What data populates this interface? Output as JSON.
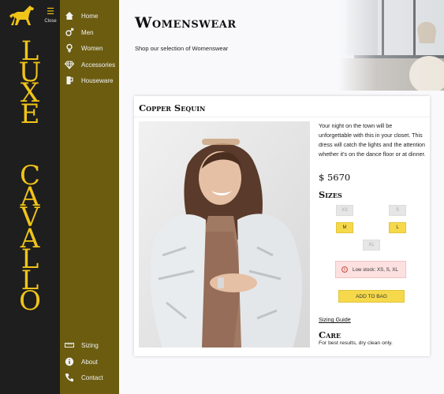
{
  "brand": {
    "word1": [
      "L",
      "U",
      "X",
      "E"
    ],
    "word2": [
      "C",
      "A",
      "V",
      "A",
      "L",
      "L",
      "O"
    ]
  },
  "close_label": "Close",
  "nav": {
    "items": [
      {
        "label": "Home",
        "icon": "home-icon"
      },
      {
        "label": "Men",
        "icon": "male-icon"
      },
      {
        "label": "Women",
        "icon": "female-icon"
      },
      {
        "label": "Accessories",
        "icon": "diamond-icon"
      },
      {
        "label": "Houseware",
        "icon": "houseware-icon"
      }
    ],
    "bottom_items": [
      {
        "label": "Sizing",
        "icon": "ruler-icon"
      },
      {
        "label": "About",
        "icon": "info-icon"
      },
      {
        "label": "Contact",
        "icon": "phone-icon"
      }
    ]
  },
  "page": {
    "title": "Womenswear",
    "subtitle": "Shop our selection of Womenswear"
  },
  "product": {
    "name": "Copper Sequin",
    "description": "Your night on the town will be unforgettable with this in your closet. This dress will catch the lights and the attention whether it's on the dance floor or at dinner.",
    "price": "$ 5670",
    "sizes_heading": "Sizes",
    "sizes": [
      {
        "label": "XS",
        "available": false
      },
      {
        "label": "S",
        "available": false
      },
      {
        "label": "M",
        "available": true
      },
      {
        "label": "L",
        "available": true
      },
      {
        "label": "XL",
        "available": false
      }
    ],
    "low_stock": "Low stock: XS, S, XL",
    "add_to_bag": "ADD TO BAG",
    "sizing_guide": "Sizing Guide",
    "care_heading": "Care",
    "care_text": "For best results, dry clean only."
  },
  "colors": {
    "brand_gold": "#f0c419",
    "nav_olive": "#6b5c10",
    "brand_dark": "#1e1e1e",
    "button_yellow": "#f6d94a",
    "lowstock_pink": "#fde0e0"
  }
}
